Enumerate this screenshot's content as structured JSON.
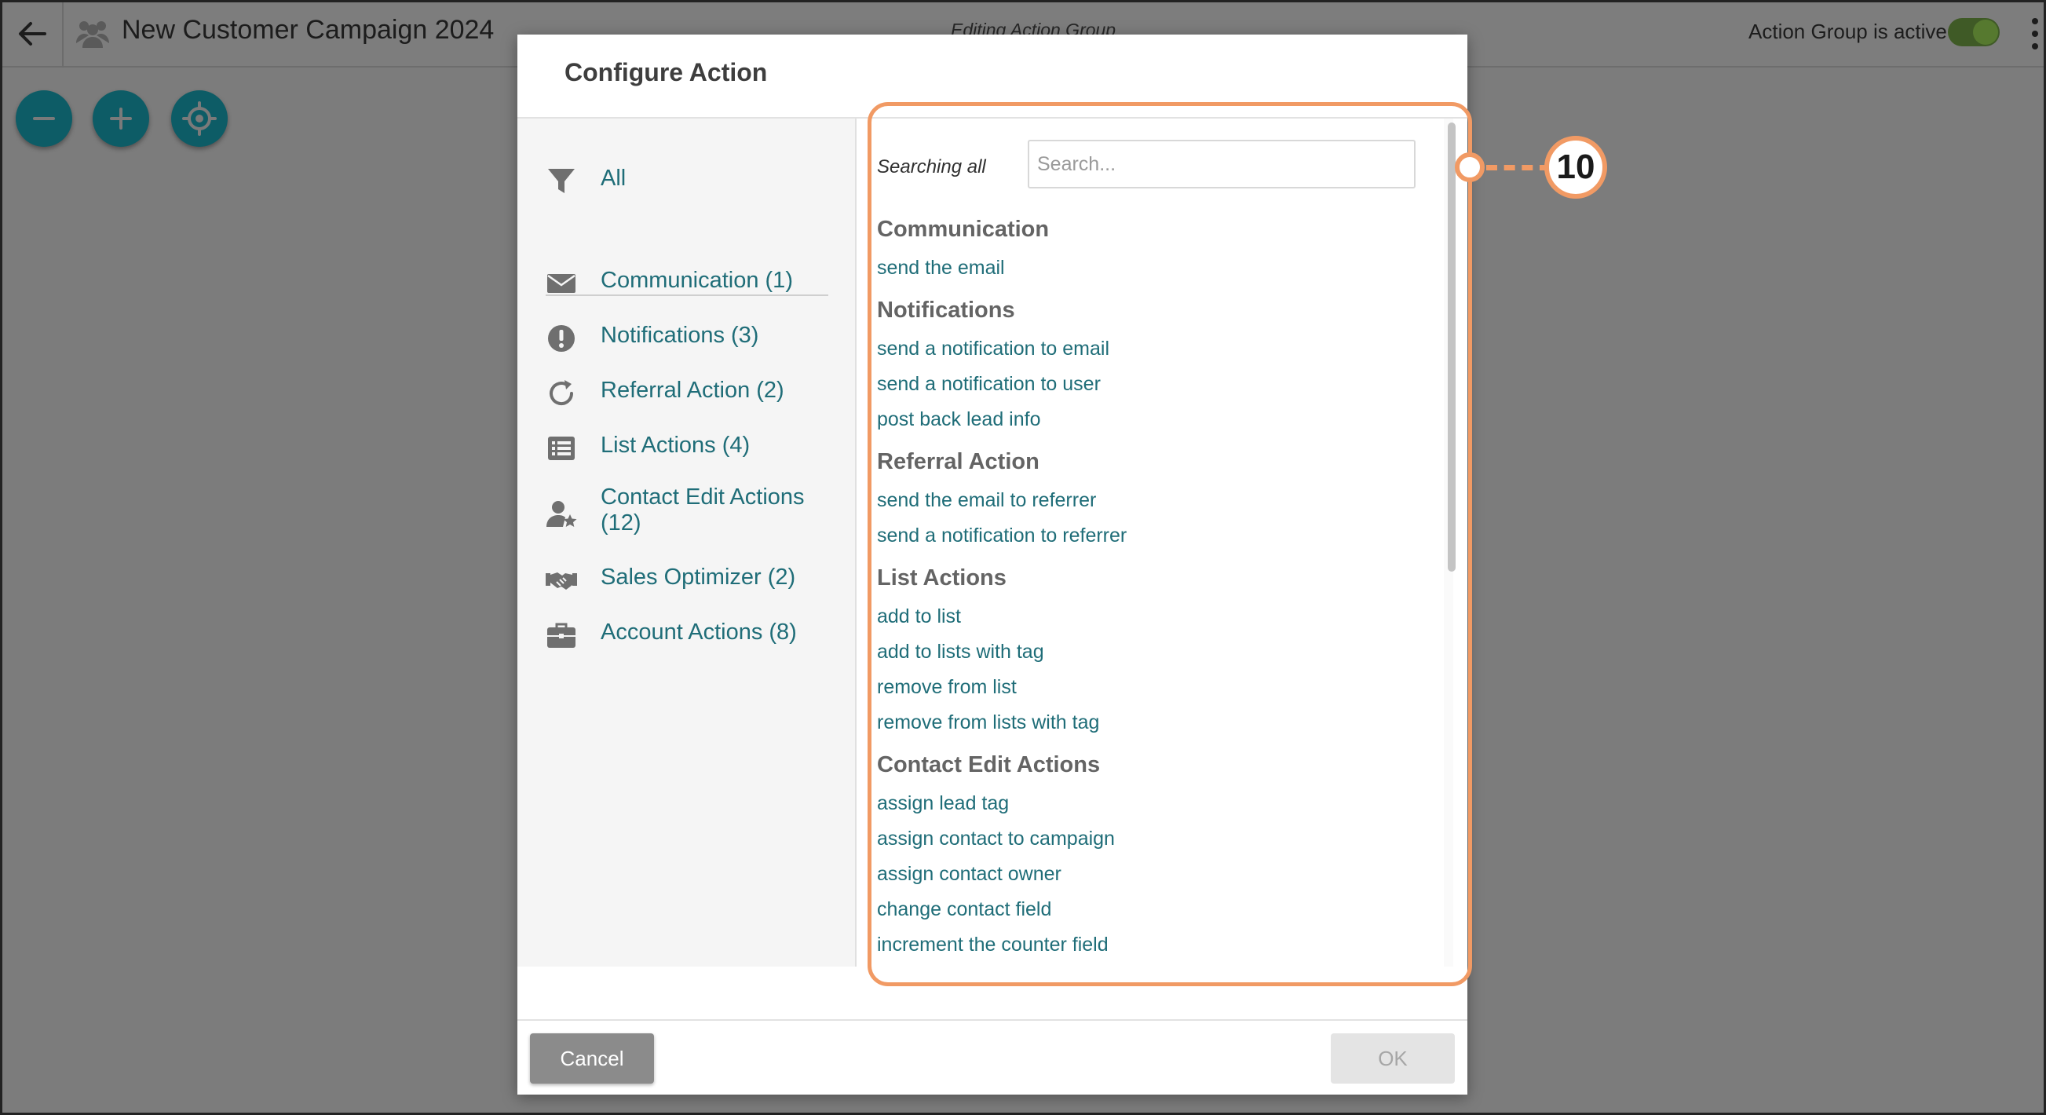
{
  "app": {
    "title": "New Customer Campaign 2024",
    "subtitle": "Editing Action Group",
    "active_label": "Action Group is active"
  },
  "modal": {
    "title": "Configure Action",
    "filter_all": "All",
    "categories": [
      {
        "label": "Communication (1)",
        "icon": "envelope-icon"
      },
      {
        "label": "Notifications (3)",
        "icon": "exclamation-circle-icon"
      },
      {
        "label": "Referral Action (2)",
        "icon": "refresh-icon"
      },
      {
        "label": "List Actions (4)",
        "icon": "list-icon"
      },
      {
        "label": "Contact Edit Actions (12)",
        "icon": "user-star-icon"
      },
      {
        "label": "Sales Optimizer (2)",
        "icon": "handshake-icon"
      },
      {
        "label": "Account Actions (8)",
        "icon": "briefcase-icon"
      }
    ],
    "search": {
      "label": "Searching all",
      "placeholder": "Search..."
    },
    "groups": [
      {
        "title": "Communication",
        "items": [
          "send the email"
        ]
      },
      {
        "title": "Notifications",
        "items": [
          "send a notification to email",
          "send a notification to user",
          "post back lead info"
        ]
      },
      {
        "title": "Referral Action",
        "items": [
          "send the email to referrer",
          "send a notification to referrer"
        ]
      },
      {
        "title": "List Actions",
        "items": [
          "add to list",
          "add to lists with tag",
          "remove from list",
          "remove from lists with tag"
        ]
      },
      {
        "title": "Contact Edit Actions",
        "items": [
          "assign lead tag",
          "assign contact to campaign",
          "assign contact owner",
          "change contact field",
          "increment the counter field"
        ]
      }
    ],
    "cancel_label": "Cancel",
    "ok_label": "OK"
  },
  "callout": {
    "number": "10",
    "color": "#f19a64"
  },
  "colors": {
    "link": "#1f6d78",
    "header_gray": "#646464",
    "action_circle": "#0d5c66"
  }
}
